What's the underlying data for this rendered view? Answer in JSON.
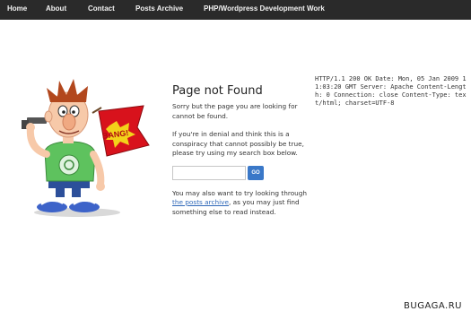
{
  "nav": {
    "items": [
      "Home",
      "About",
      "Contact",
      "Posts Archive",
      "PHP/Wordpress Development Work"
    ]
  },
  "illustration": {
    "flag_text": "BANG!",
    "icon": "cartoon-man-gun-icon"
  },
  "content": {
    "title": "Page not Found",
    "para1": "Sorry but the page you are looking for cannot be found.",
    "para2": "If you're in denial and think this is a conspiracy that cannot possibly be true, please try using my search box below.",
    "search": {
      "value": "",
      "placeholder": "",
      "button_label": "GO"
    },
    "para3_before": "You may also want to try looking through ",
    "para3_link": "the posts archive",
    "para3_after": ", as you may just find something else to read instead."
  },
  "http_headers": "HTTP/1.1 200 OK Date: Mon, 05 Jan 2009 11:03:20 GMT Server: Apache Content-Length: 0 Connection: close Content-Type: text/html; charset=UTF-8",
  "watermark": "BUGAGA.RU",
  "colors": {
    "navbar_bg": "#2a2a2a",
    "link": "#2f68b8",
    "button": "#3a78c8",
    "flag": "#d8121c",
    "shirt": "#5ec25e",
    "pants": "#2c4f9a"
  }
}
